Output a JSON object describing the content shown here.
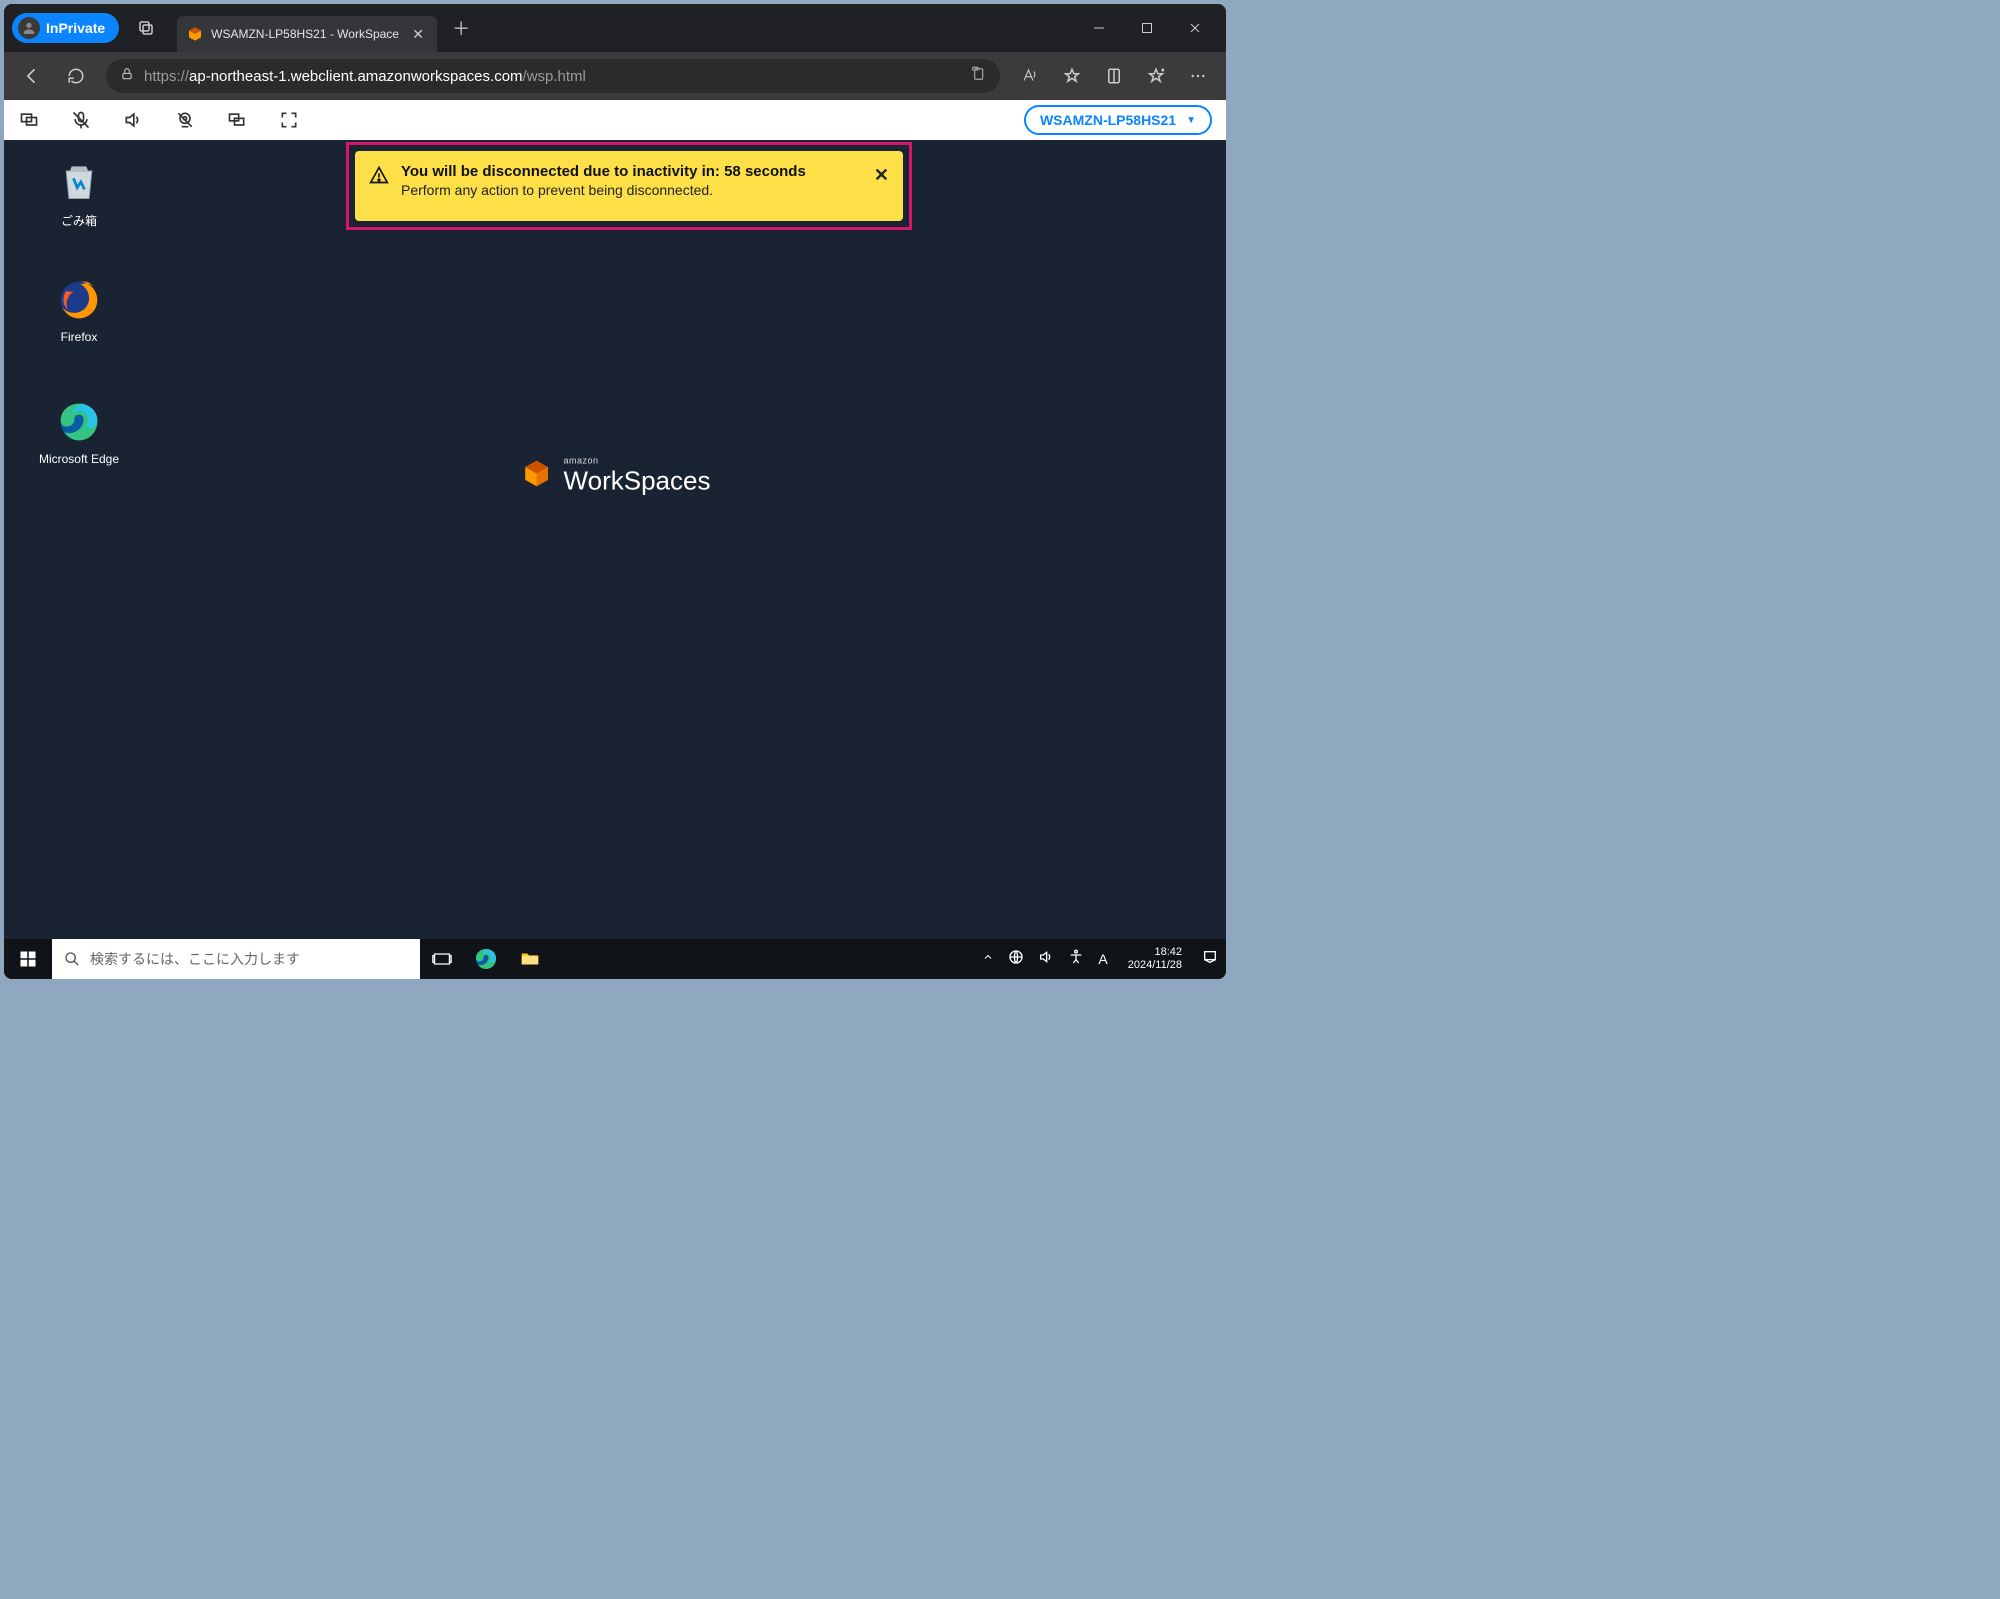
{
  "browser": {
    "inprivate_label": "InPrivate",
    "tab_title": "WSAMZN-LP58HS21 - WorkSpace",
    "url_scheme": "https://",
    "url_host": "ap-northeast-1.webclient.amazonworkspaces.com",
    "url_path": "/wsp.html"
  },
  "workspaces_toolbar": {
    "machine_label": "WSAMZN-LP58HS21"
  },
  "banner": {
    "title": "You will be disconnected due to inactivity in: 58 seconds",
    "subtitle": "Perform any action to prevent being disconnected."
  },
  "desktop": {
    "recycle_label": "ごみ箱",
    "firefox_label": "Firefox",
    "edge_label": "Microsoft Edge"
  },
  "wallpaper": {
    "small": "amazon",
    "big": "WorkSpaces"
  },
  "taskbar": {
    "search_placeholder": "検索するには、ここに入力します",
    "ime_label": "A",
    "time": "18:42",
    "date": "2024/11/28"
  }
}
